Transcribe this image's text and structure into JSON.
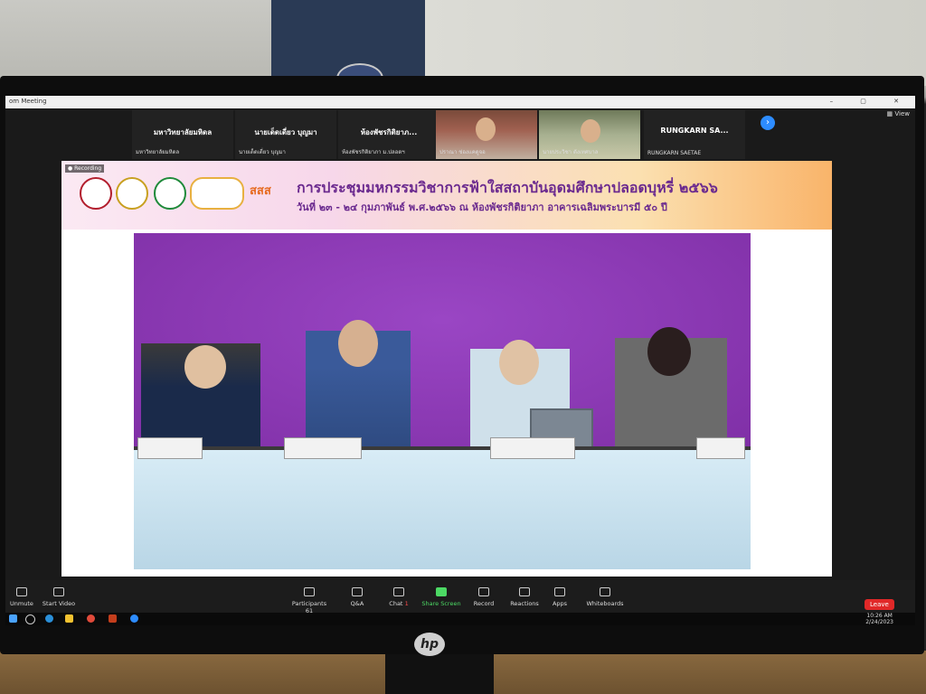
{
  "window": {
    "title": "om Meeting",
    "view_label": "View"
  },
  "thumbnails": [
    {
      "name": "มหาวิทยาลัยมหิดล",
      "caption": "มหาวิทยาลัยมหิดล"
    },
    {
      "name": "นายเด็ดเดี่ยว บุญมา",
      "caption": "นายเด็ดเดี่ยว บุญมา"
    },
    {
      "name": "ห้องพัชรกิติยาภ...",
      "caption": "ห้องพัชรกิติยาภา ม.ปลอดฯ"
    },
    {
      "name": "",
      "caption": "ปราณา ช่องแคดูจอ"
    },
    {
      "name": "",
      "caption": "นายประวิชา ดังเทศบาล"
    },
    {
      "name": "RUNGKARN SA...",
      "caption": "RUNGKARN SAETAE"
    }
  ],
  "share": {
    "recording": "Recording",
    "title": "การประชุมมหกรรมวิชาการฟ้าใสสถาบันอุดมศึกษาปลอดบุหรี่ ๒๕๖๖",
    "subtitle": "วันที่ ๒๓ - ๒๔ กุมภาพันธ์ พ.ศ.๒๕๖๖ ณ ห้องพัชรกิติยาภา อาคารเฉลิมพระบารมี ๕๐ ปี",
    "logo_text": "สสส"
  },
  "toolbar": {
    "unmute": "Unmute",
    "start_video": "Start Video",
    "participants": "Participants",
    "participants_count": "61",
    "qa": "Q&A",
    "chat": "Chat",
    "chat_badge": "1",
    "share_screen": "Share Screen",
    "record": "Record",
    "reactions": "Reactions",
    "apps": "Apps",
    "whiteboards": "Whiteboards",
    "leave": "Leave"
  },
  "taskbar": {
    "time": "10:26 AM",
    "date": "2/24/2023"
  },
  "monitor": {
    "brand": "hp"
  }
}
